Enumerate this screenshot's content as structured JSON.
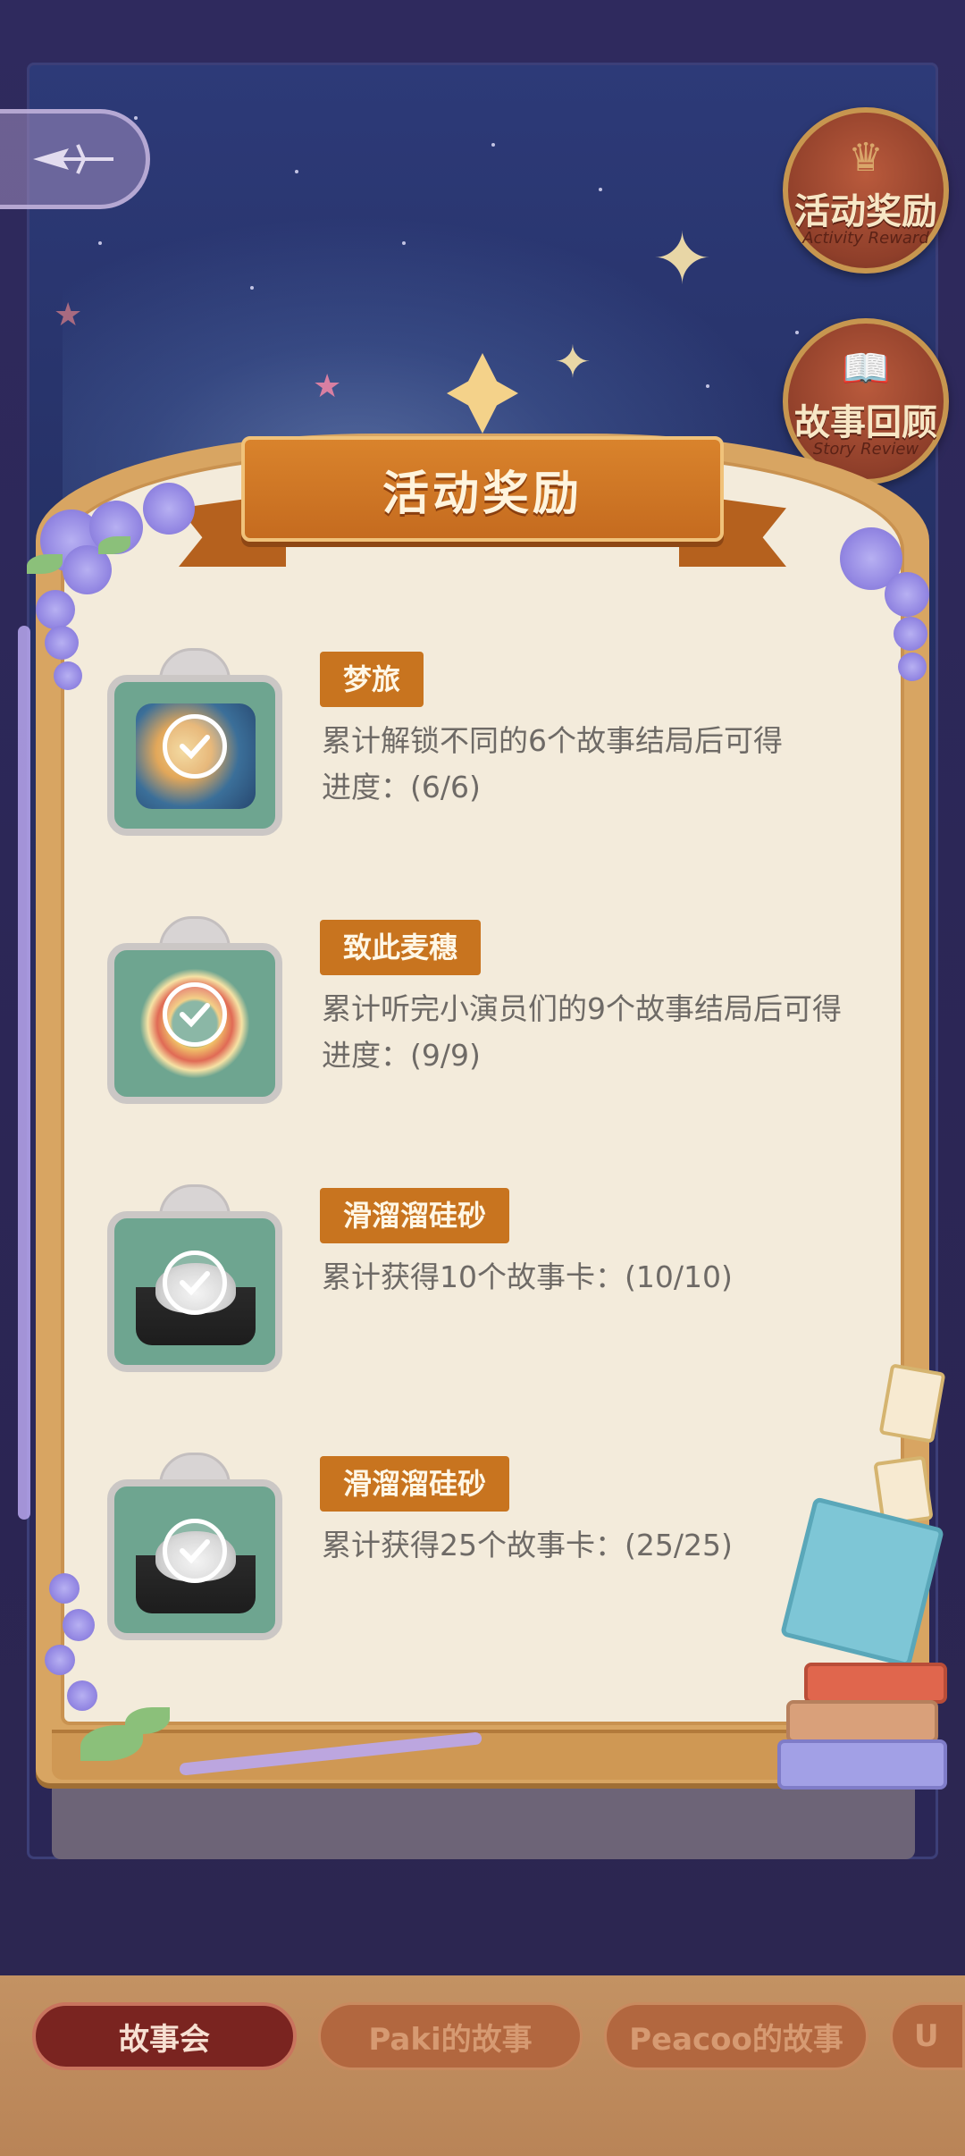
{
  "side_buttons": {
    "activity_reward": {
      "cn": "活动奖励",
      "en": "Activity Reward"
    },
    "story_review": {
      "cn": "故事回顾",
      "en": "Story Review"
    }
  },
  "panel": {
    "title": "活动奖励",
    "rewards": [
      {
        "name": "梦旅",
        "description": "累计解锁不同的6个故事结局后可得",
        "progress": "进度：(6/6)",
        "claimed": true
      },
      {
        "name": "致此麦穗",
        "description": "累计听完小演员们的9个故事结局后可得",
        "progress": "进度：(9/9)",
        "claimed": true
      },
      {
        "name": "滑溜溜硅砂",
        "description": "累计获得10个故事卡：(10/10)",
        "progress": "",
        "claimed": true
      },
      {
        "name": "滑溜溜硅砂",
        "description": "累计获得25个故事卡：(25/25)",
        "progress": "",
        "claimed": true
      }
    ]
  },
  "tabs": [
    {
      "label": "故事会",
      "active": true
    },
    {
      "label": "Paki的故事",
      "active": false
    },
    {
      "label": "Peacoo的故事",
      "active": false
    },
    {
      "label": "U",
      "active": false
    }
  ],
  "colors": {
    "accent": "#c8741f",
    "active_tab": "#7a2420",
    "panel_bg": "#f3ebdb",
    "gift_box": "#6ea590"
  }
}
